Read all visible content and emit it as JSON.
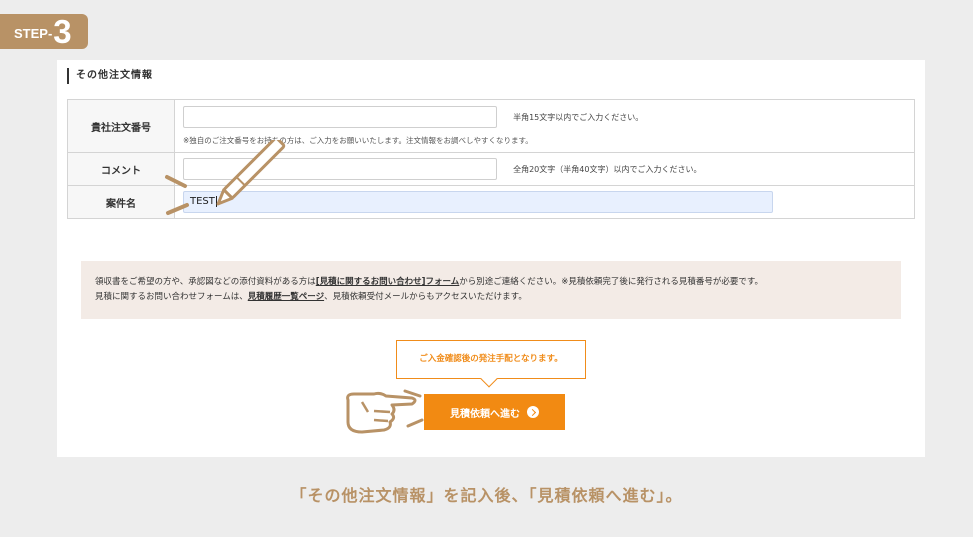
{
  "step": {
    "label": "STEP-",
    "number": "3"
  },
  "section": {
    "title": "その他注文情報"
  },
  "form": {
    "order_number": {
      "label": "貴社注文番号",
      "value": "",
      "hint": "半角15文字以内でご入力ください。",
      "note": "※独自のご注文番号をお持ちの方は、ご入力をお願いいたします。注文情報をお調べしやすくなります。"
    },
    "comment": {
      "label": "コメント",
      "value": "",
      "hint": "全角20文字（半角40文字）以内でご入力ください。"
    },
    "case_name": {
      "label": "案件名",
      "value": "TEST"
    }
  },
  "info": {
    "line1_pre": "領収書をご希望の方や、承認図などの添付資料がある方は",
    "line1_link": "[見積に関するお問い合わせ]フォーム",
    "line1_post": "から別途ご連絡ください。※見積依頼完了後に発行される見積番号が必要です。",
    "line2_pre": "見積に関するお問い合わせフォームは、",
    "line2_link": "見積履歴一覧ページ",
    "line2_post": "、見積依頼受付メールからもアクセスいただけます。"
  },
  "tooltip": {
    "text": "ご入金確認後の発注手配となります。"
  },
  "proceed_button": {
    "label": "見積依頼へ進む"
  },
  "caption": {
    "text": "「その他注文情報」を記入後、「見積依頼へ進む」。"
  },
  "colors": {
    "accent": "#f28a12",
    "brown": "#b89266",
    "info_bg": "#f3ebe6",
    "autofill_bg": "#e8f0fe"
  },
  "icons": {
    "pencil": "pencil-icon",
    "pointing_hand": "pointing-hand-icon",
    "arrow": "arrow-right-circle-icon"
  }
}
